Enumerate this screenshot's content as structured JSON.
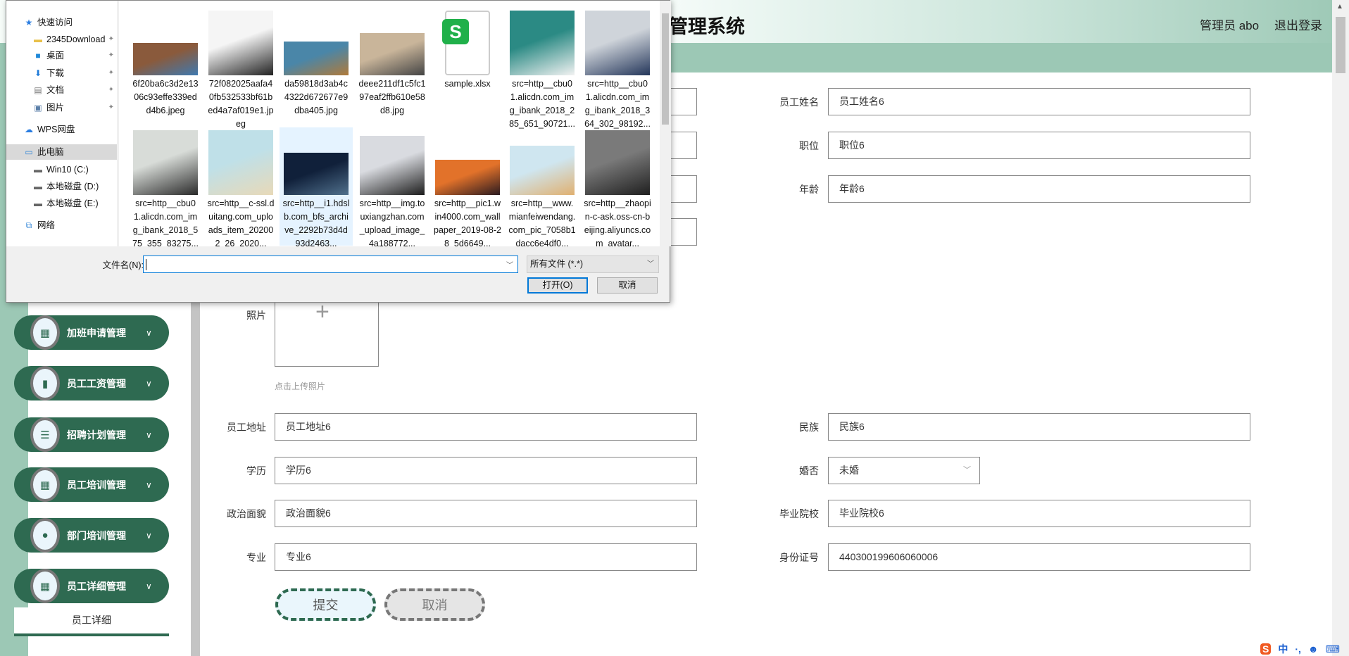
{
  "header": {
    "title": "管理系统",
    "admin": "管理员 abo",
    "logout": "退出登录"
  },
  "sidebar": {
    "items": [
      {
        "label": "加班申请管理",
        "icon": "grid"
      },
      {
        "label": "员工工资管理",
        "icon": "bar-chart"
      },
      {
        "label": "招聘计划管理",
        "icon": "list"
      },
      {
        "label": "员工培训管理",
        "icon": "grid"
      },
      {
        "label": "部门培训管理",
        "icon": "user"
      },
      {
        "label": "员工详细管理",
        "icon": "grid"
      }
    ],
    "submenu": "员工详细"
  },
  "form": {
    "right_top": [
      {
        "label": "员工姓名",
        "value": "员工姓名6"
      },
      {
        "label": "职位",
        "value": "职位6"
      },
      {
        "label": "年龄",
        "value": "年龄6"
      }
    ],
    "photo_label": "照片",
    "upload_hint": "点击上传照片",
    "left_rows": [
      {
        "label": "员工地址",
        "value": "员工地址6"
      },
      {
        "label": "学历",
        "value": "学历6"
      },
      {
        "label": "政治面貌",
        "value": "政治面貌6"
      },
      {
        "label": "专业",
        "value": "专业6"
      }
    ],
    "right_rows": [
      {
        "label": "民族",
        "value": "民族6"
      },
      {
        "label": "婚否",
        "value": "未婚",
        "type": "select"
      },
      {
        "label": "毕业院校",
        "value": "毕业院校6"
      },
      {
        "label": "身份证号",
        "value": "440300199606060006"
      }
    ],
    "submit": "提交",
    "cancel": "取消"
  },
  "dialog": {
    "nav": [
      {
        "label": "快速访问",
        "icon": "star",
        "level": 0
      },
      {
        "label": "2345Download",
        "icon": "folder",
        "level": 1,
        "pinned": true
      },
      {
        "label": "桌面",
        "icon": "desktop",
        "level": 1,
        "pinned": true
      },
      {
        "label": "下载",
        "icon": "download",
        "level": 1,
        "pinned": true
      },
      {
        "label": "文档",
        "icon": "document",
        "level": 1,
        "pinned": true
      },
      {
        "label": "图片",
        "icon": "picture",
        "level": 1,
        "pinned": true
      },
      {
        "label": "WPS网盘",
        "icon": "cloud",
        "level": 0
      },
      {
        "label": "此电脑",
        "icon": "computer",
        "level": 0,
        "selected": true
      },
      {
        "label": "Win10 (C:)",
        "icon": "drive",
        "level": 1
      },
      {
        "label": "本地磁盘 (D:)",
        "icon": "drive",
        "level": 1
      },
      {
        "label": "本地磁盘 (E:)",
        "icon": "drive",
        "level": 1
      },
      {
        "label": "网络",
        "icon": "network",
        "level": 0
      }
    ],
    "files": [
      {
        "name": "6f20ba6c3d2e1306c93effe339edd4b6.jpeg",
        "colors": [
          "#8a5a3c",
          "#3f79b0"
        ]
      },
      {
        "name": "72f082025aafa40fb532533bf61bed4a7af019e1.jpeg",
        "colors": [
          "#f5f5f5",
          "#222222"
        ]
      },
      {
        "name": "da59818d3ab4c4322d672677e9dba405.jpg",
        "colors": [
          "#4a86a8",
          "#b07a3a"
        ]
      },
      {
        "name": "deee211df1c5fc197eaf2ffb610e58d8.jpg",
        "colors": [
          "#c9b59a",
          "#444444"
        ]
      },
      {
        "name": "sample.xlsx",
        "colors": [
          "#ffffff",
          "#20b04a"
        ]
      },
      {
        "name": "src=http__cbu01.alicdn.com_img_ibank_2018_285_651_90721...",
        "colors": [
          "#2b8a84",
          "#f2f2f2"
        ]
      },
      {
        "name": "src=http__cbu01.alicdn.com_img_ibank_2018_364_302_98192...",
        "colors": [
          "#cfd4da",
          "#24365a"
        ]
      },
      {
        "name": "src=http__cbu01.alicdn.com_img_ibank_2018_575_355_83275...",
        "colors": [
          "#d8dcd8",
          "#2a2a2a"
        ]
      },
      {
        "name": "src=http__c-ssl.duitang.com_uploads_item_202002_26_2020...",
        "colors": [
          "#bfe0e8",
          "#e8d9b8"
        ]
      },
      {
        "name": "src=http__i1.hdslb.com_bfs_archive_2292b73d4d93d2463...",
        "colors": [
          "#10203a",
          "#50708c"
        ],
        "selected": true
      },
      {
        "name": "src=http__img.touxiangzhan.com_upload_image_4a188772...",
        "colors": [
          "#d9dbe0",
          "#1c1c1c"
        ]
      },
      {
        "name": "src=http__pic1.win4000.com_wallpaper_2019-08-28_5d6649...",
        "colors": [
          "#e2722a",
          "#2a1a20"
        ]
      },
      {
        "name": "src=http__www.mianfeiwendang.com_pic_7058b1dacc6e4df0...",
        "colors": [
          "#cfe6f0",
          "#e0b070"
        ]
      },
      {
        "name": "src=http__zhaopin-c-ask.oss-cn-beijing.aliyuncs.com_avatar...",
        "colors": [
          "#7a7a7a",
          "#1f1f1f"
        ]
      }
    ],
    "filename_label": "文件名(N):",
    "filename_value": "",
    "filter": "所有文件 (*.*)",
    "open": "打开(O)",
    "cancel": "取消"
  },
  "tray": {
    "ime": "中",
    "punct": "·,"
  }
}
